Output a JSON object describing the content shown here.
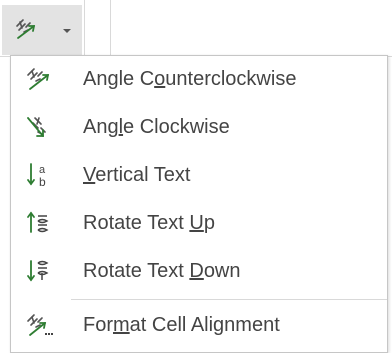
{
  "toolbar": {
    "button_name": "orientation-button",
    "icon": "orientation-icon",
    "arrow_icon": "chevron-down-icon",
    "accent_color": "#2e7d32"
  },
  "menu": {
    "items": [
      {
        "before": "Angle C",
        "mnemonic": "o",
        "after": "unterclockwise",
        "icon": "angle-counterclockwise-icon"
      },
      {
        "before": "Ang",
        "mnemonic": "l",
        "after": "e Clockwise",
        "icon": "angle-clockwise-icon"
      },
      {
        "before": "",
        "mnemonic": "V",
        "after": "ertical Text",
        "icon": "vertical-text-icon"
      },
      {
        "before": "Rotate Text ",
        "mnemonic": "U",
        "after": "p",
        "icon": "rotate-text-up-icon"
      },
      {
        "before": "Rotate Text ",
        "mnemonic": "D",
        "after": "own",
        "icon": "rotate-text-down-icon"
      },
      {
        "before": "For",
        "mnemonic": "m",
        "after": "at Cell Alignment",
        "icon": "format-cell-alignment-icon"
      }
    ]
  }
}
